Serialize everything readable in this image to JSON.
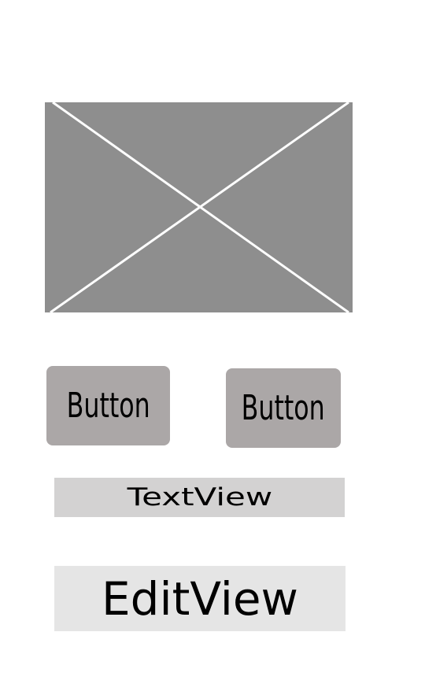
{
  "image_placeholder": {
    "icon": "image-placeholder-icon",
    "fill_color": "#8e8e8e",
    "line_color": "#ffffff"
  },
  "buttons": [
    {
      "label": "Button",
      "color": "#aba7a7"
    },
    {
      "label": "Button",
      "color": "#aba7a7"
    }
  ],
  "textview": {
    "text": "TextView",
    "background": "#d3d2d2"
  },
  "editview": {
    "text": "EditView",
    "background": "#e5e5e5"
  }
}
